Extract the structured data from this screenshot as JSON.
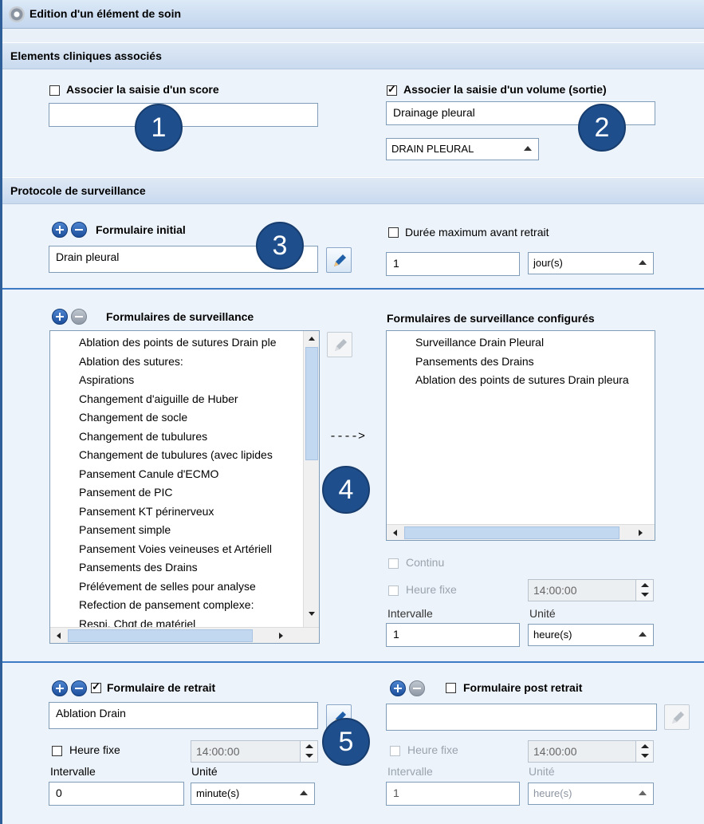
{
  "window": {
    "title": "Edition d'un élément de soin"
  },
  "sections": {
    "clinical": "Elements cliniques associés",
    "protocol": "Protocole de surveillance"
  },
  "clinical": {
    "score_label": "Associer la saisie d'un score",
    "score_checked": false,
    "score_value": "",
    "volume_label": "Associer la saisie d'un volume (sortie)",
    "volume_checked": true,
    "volume_value": "Drainage pleural",
    "volume_type": "DRAIN PLEURAL"
  },
  "initial": {
    "label": "Formulaire initial",
    "value": "Drain pleural",
    "max_label": "Durée maximum avant retrait",
    "max_checked": false,
    "max_value": "1",
    "max_unit": "jour(s)"
  },
  "surveillance": {
    "label": "Formulaires de surveillance",
    "items": [
      "Ablation des points de sutures Drain ple",
      "Ablation des sutures:",
      "Aspirations",
      "Changement d'aiguille de Huber",
      "Changement de socle",
      "Changement de tubulures",
      "Changement de tubulures (avec lipides",
      "Pansement Canule d'ECMO",
      "Pansement de PIC",
      "Pansement KT périnerveux",
      "Pansement simple",
      "Pansement Voies veineuses et Artériell",
      "Pansements des Drains",
      "Prélévement de selles pour analyse",
      "Refection de pansement complexe:",
      "Respi. Chgt de matériel"
    ],
    "arrow": "---->",
    "configured_label": "Formulaires de surveillance configurés",
    "configured": [
      "Surveillance Drain Pleural",
      "Pansements des Drains",
      "Ablation des points de sutures Drain pleura"
    ],
    "continu_label": "Continu",
    "heure_fixe_label": "Heure fixe",
    "heure_fixe_value": "14:00:00",
    "intervalle_label": "Intervalle",
    "intervalle_value": "1",
    "unite_label": "Unité",
    "unite_value": "heure(s)"
  },
  "retrait": {
    "label": "Formulaire de retrait",
    "checked": true,
    "value": "Ablation Drain",
    "heure_fixe_label": "Heure fixe",
    "heure_fixe_value": "14:00:00",
    "intervalle_label": "Intervalle",
    "intervalle_value": "0",
    "unite_label": "Unité",
    "unite_value": "minute(s)"
  },
  "post": {
    "label": "Formulaire post retrait",
    "checked": false,
    "value": "",
    "heure_fixe_label": "Heure fixe",
    "heure_fixe_value": "14:00:00",
    "intervalle_label": "Intervalle",
    "intervalle_value": "1",
    "unite_label": "Unité",
    "unite_value": "heure(s)"
  },
  "badges": [
    "1",
    "2",
    "3",
    "4",
    "5"
  ],
  "colors": {
    "badge": "#1f4e8c",
    "separator": "#3f7ac7",
    "panel": "#edf3fa"
  }
}
